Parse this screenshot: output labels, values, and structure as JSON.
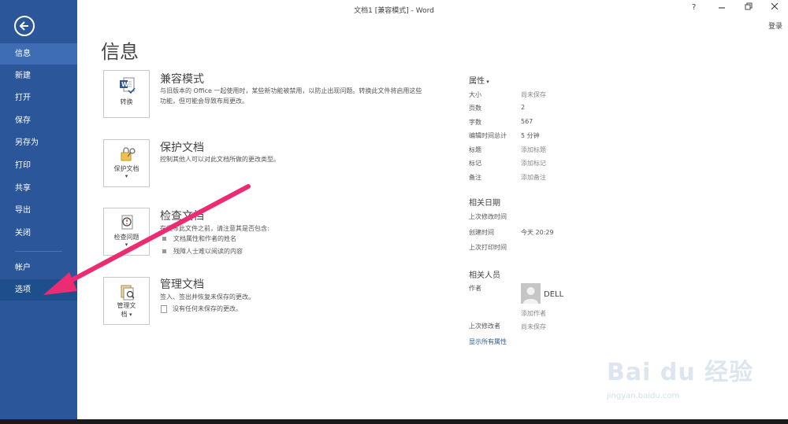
{
  "window": {
    "title": "文档1 [兼容模式] - Word",
    "help_label": "?",
    "signin_label": "登录"
  },
  "nav": {
    "items": [
      {
        "label": "信息",
        "state": "active"
      },
      {
        "label": "新建"
      },
      {
        "label": "打开"
      },
      {
        "label": "保存"
      },
      {
        "label": "另存为"
      },
      {
        "label": "打印"
      },
      {
        "label": "共享"
      },
      {
        "label": "导出"
      },
      {
        "label": "关闭"
      },
      {
        "label": "帐户"
      },
      {
        "label": "选项",
        "state": "hover"
      }
    ]
  },
  "page": {
    "title": "信息"
  },
  "sections": {
    "convert": {
      "card_label": "转换",
      "title": "兼容模式",
      "desc": "与旧版本的 Office 一起使用时，某些新功能被禁用，以防止出现问题。转换此文件将启用这些功能，但可能会导致布局更改。"
    },
    "protect": {
      "card_label": "保护文档",
      "title": "保护文档",
      "desc": "控制其他人可以对此文档所做的更改类型。"
    },
    "inspect": {
      "card_label": "检查问题",
      "title": "检查文档",
      "desc": "在发布此文件之前，请注意其是否包含:",
      "bullets": [
        "文档属性和作者的姓名",
        "残障人士难以阅读的内容"
      ]
    },
    "manage": {
      "card_label_1": "管理文",
      "card_label_2": "档",
      "title": "管理文档",
      "desc": "签入、签出并恢复未保存的更改。",
      "note": "没有任何未保存的更改。"
    }
  },
  "properties": {
    "header": "属性",
    "rows": [
      {
        "label": "大小",
        "value": "尚未保存"
      },
      {
        "label": "页数",
        "value": "2"
      },
      {
        "label": "字数",
        "value": "567"
      },
      {
        "label": "编辑时间总计",
        "value": "5 分钟"
      },
      {
        "label": "标题",
        "value": "添加标题"
      },
      {
        "label": "标记",
        "value": "添加标记"
      },
      {
        "label": "备注",
        "value": "添加备注"
      }
    ],
    "dates_header": "相关日期",
    "dates": [
      {
        "label": "上次修改时间",
        "value": ""
      },
      {
        "label": "创建时间",
        "value": "今天 20:29"
      },
      {
        "label": "上次打印时间",
        "value": ""
      }
    ],
    "people_header": "相关人员",
    "author_label": "作者",
    "author_name": "DELL",
    "add_author": "添加作者",
    "last_modified_by_label": "上次修改者",
    "last_modified_by_value": "尚未保存",
    "show_all": "显示所有属性"
  },
  "watermark": {
    "brand": "Bai du 经验",
    "url": "jingyan.baidu.com"
  },
  "colors": {
    "sidebar": "#2b579a",
    "accent_arrow": "#ec2c72"
  }
}
